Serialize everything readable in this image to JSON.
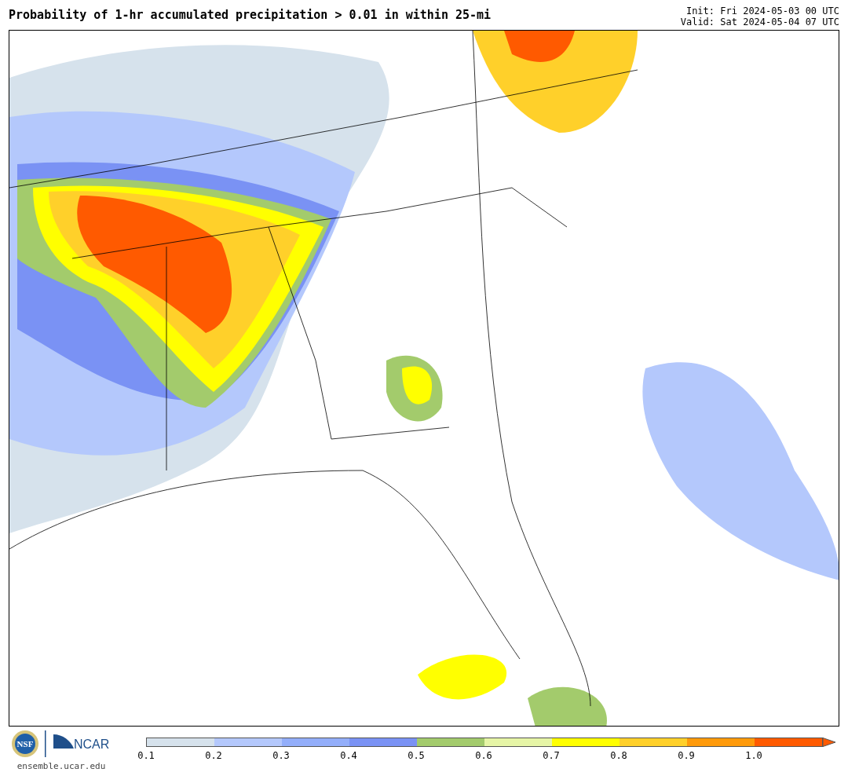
{
  "title": "Probability of 1-hr accumulated precipitation > 0.01 in within 25-mi",
  "init": "Init: Fri 2024-05-03 00 UTC",
  "valid": "Valid: Sat 2024-05-04 07 UTC",
  "logos": {
    "left": "NSF",
    "right": "NCAR"
  },
  "site": "ensemble.ucar.edu",
  "colorbar": {
    "segments": [
      {
        "color": "#d6e2ec"
      },
      {
        "color": "#b4c8fc"
      },
      {
        "color": "#93aefa"
      },
      {
        "color": "#7a92f4"
      },
      {
        "color": "#a3cb6c"
      },
      {
        "color": "#e6f5a6"
      },
      {
        "color": "#ffff00"
      },
      {
        "color": "#ffd02a"
      },
      {
        "color": "#ff9a0a"
      },
      {
        "color": "#ff5a00"
      }
    ],
    "ticks": [
      "0.1",
      "0.2",
      "0.3",
      "0.4",
      "0.5",
      "0.6",
      "0.7",
      "0.8",
      "0.9",
      "1.0"
    ]
  }
}
